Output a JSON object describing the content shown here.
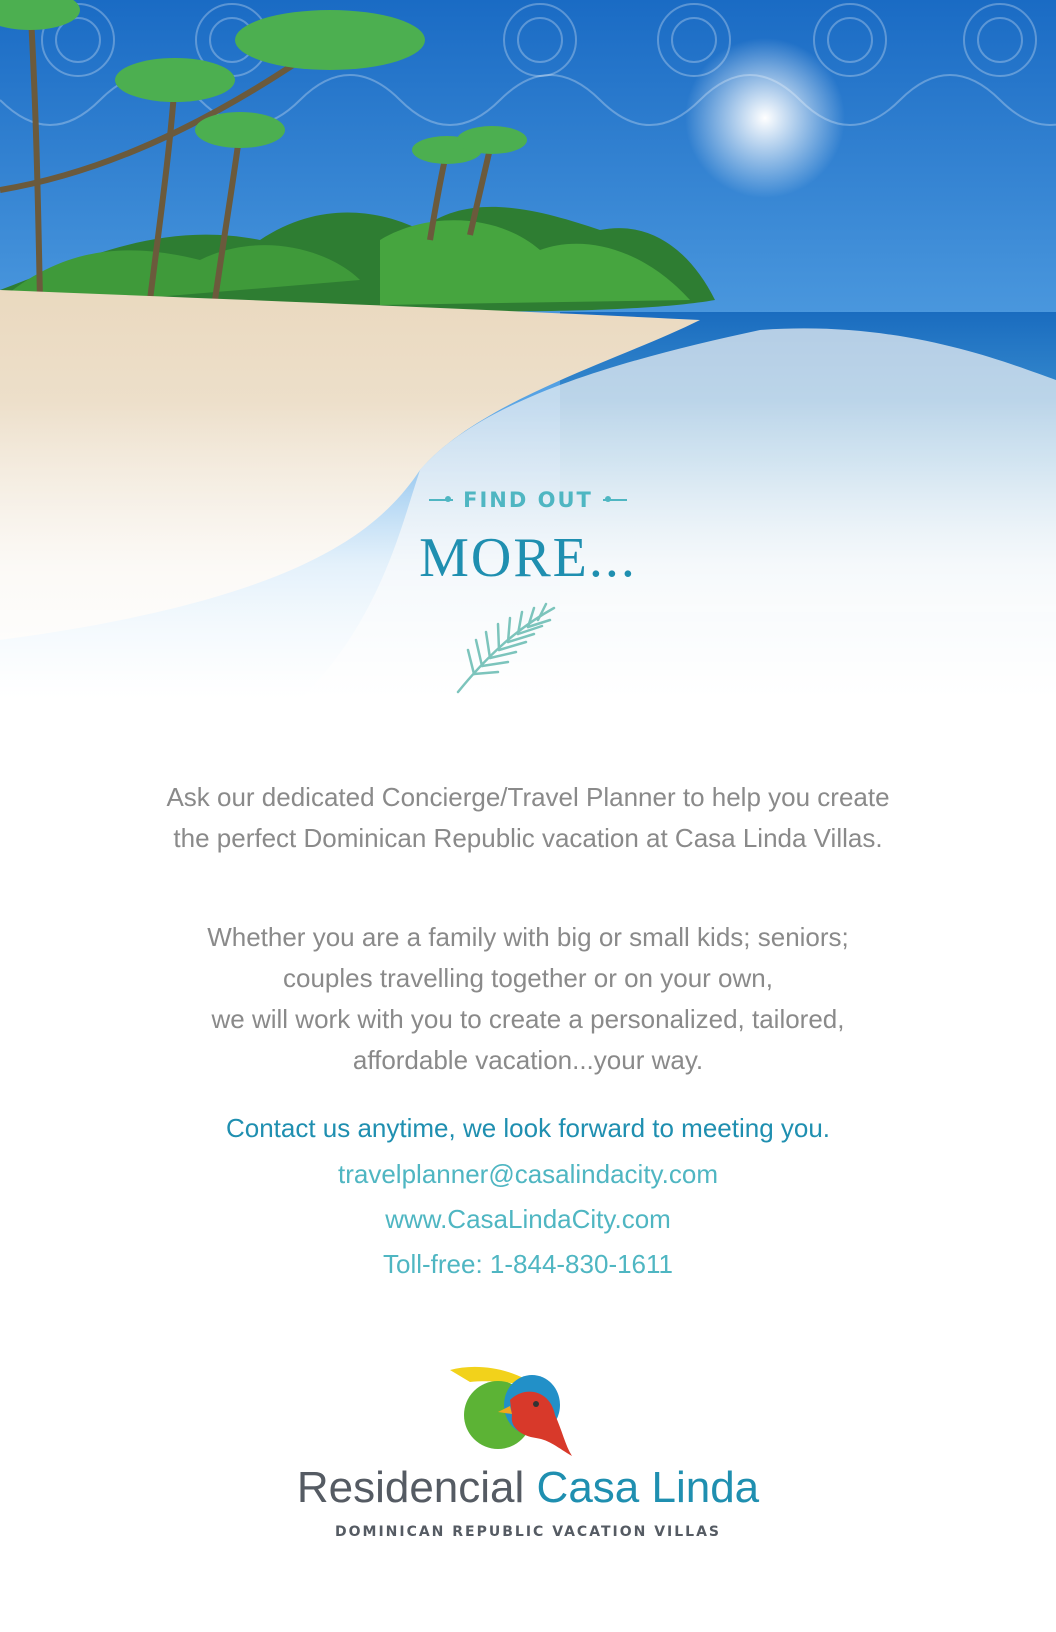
{
  "hero": {
    "kicker": "FIND OUT",
    "title": "MORE..."
  },
  "body": {
    "paragraph1_lines": [
      "Ask our dedicated Concierge/Travel Planner to help you create",
      "the perfect Dominican Republic vacation at Casa Linda Villas."
    ],
    "paragraph2_lines": [
      "Whether you are a family with big or small kids; seniors;",
      "couples travelling together or on your own,",
      "we will work with you to create a personalized, tailored,",
      "affordable vacation...your way."
    ]
  },
  "contact": {
    "headline": "Contact us anytime, we look forward to meeting you.",
    "email": "travelplanner@casalindacity.com",
    "website": "www.CasaLindaCity.com",
    "phone": "Toll-free:  1-844-830-1611"
  },
  "brand": {
    "name_part1": "Residencial",
    "name_part2": "Casa Linda",
    "tagline": "DOMINICAN REPUBLIC VACATION VILLAS"
  },
  "colors": {
    "accent": "#1f8fb0",
    "teal": "#4fb6c2",
    "text_gray": "#8a8a8a",
    "brand_gray": "#555b63"
  },
  "icons": [
    "palm-frond-icon",
    "bird-logo-icon"
  ]
}
